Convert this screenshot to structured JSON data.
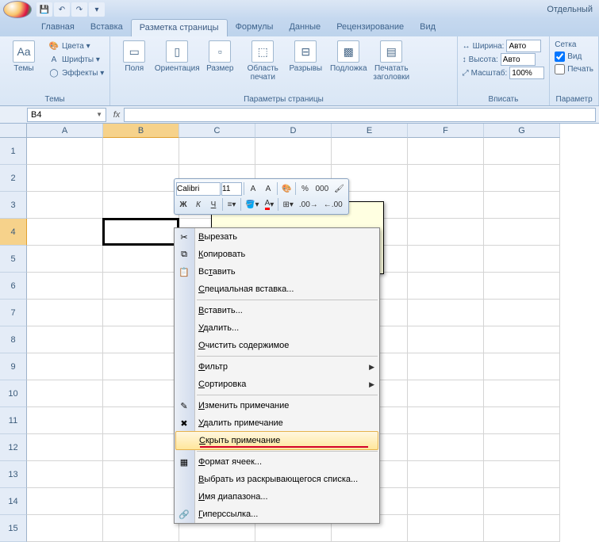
{
  "title": "Отдельный",
  "qat": {
    "save": "💾",
    "undo": "↶",
    "redo": "↷",
    "more": "▾"
  },
  "tabs": [
    "Главная",
    "Вставка",
    "Разметка страницы",
    "Формулы",
    "Данные",
    "Рецензирование",
    "Вид"
  ],
  "active_tab": 2,
  "ribbon": {
    "themes": {
      "btn": "Темы",
      "colors": "Цвета ▾",
      "fonts": "Шрифты ▾",
      "effects": "Эффекты ▾",
      "label": "Темы"
    },
    "page_setup": {
      "margins": "Поля",
      "orientation": "Ориентация",
      "size": "Размер",
      "print_area": "Область печати",
      "breaks": "Разрывы",
      "background": "Подложка",
      "print_titles": "Печатать заголовки",
      "label": "Параметры страницы"
    },
    "scale": {
      "width_lbl": "Ширина:",
      "width_val": "Авто",
      "height_lbl": "Высота:",
      "height_val": "Авто",
      "scale_lbl": "Масштаб:",
      "scale_val": "100%",
      "label": "Вписать"
    },
    "sheet": {
      "grid": "Сетка",
      "view": "Вид",
      "print": "Печать",
      "label": "Параметр"
    }
  },
  "namebox": "B4",
  "columns": [
    "A",
    "B",
    "C",
    "D",
    "E",
    "F",
    "G"
  ],
  "rows": [
    1,
    2,
    3,
    4,
    5,
    6,
    7,
    8,
    9,
    10,
    11,
    12,
    13,
    14,
    15
  ],
  "sel_col": 1,
  "sel_row": 3,
  "minitoolbar": {
    "font": "Calibri",
    "size": "11",
    "grow": "A",
    "shrink": "A",
    "bold": "Ж",
    "italic": "К",
    "underline": "Ч",
    "percent": "%",
    "comma": "000"
  },
  "context_menu": [
    {
      "icon": "✂",
      "label": "Вырезать",
      "u": 0
    },
    {
      "icon": "⧉",
      "label": "Копировать",
      "u": 0
    },
    {
      "icon": "📋",
      "label": "Вставить",
      "u": 2
    },
    {
      "label": "Специальная вставка...",
      "u": 0
    },
    {
      "sep": true
    },
    {
      "label": "Вставить...",
      "u": 0
    },
    {
      "label": "Удалить...",
      "u": 0
    },
    {
      "label": "Очистить содержимое",
      "u": 0
    },
    {
      "sep": true
    },
    {
      "label": "Фильтр",
      "u": 0,
      "sub": true
    },
    {
      "label": "Сортировка",
      "u": 0,
      "sub": true
    },
    {
      "sep": true
    },
    {
      "icon": "✎",
      "label": "Изменить примечание",
      "u": 0
    },
    {
      "icon": "✖",
      "label": "Удалить примечание",
      "u": 0
    },
    {
      "label": "Скрыть примечание",
      "u": 0,
      "hl": true,
      "red": true
    },
    {
      "sep": true
    },
    {
      "icon": "▦",
      "label": "Формат ячеек...",
      "u": 0
    },
    {
      "label": "Выбрать из раскрывающегося списка...",
      "u": 0
    },
    {
      "label": "Имя диапазона...",
      "u": 0
    },
    {
      "icon": "🔗",
      "label": "Гиперссылка...",
      "u": 0
    }
  ]
}
